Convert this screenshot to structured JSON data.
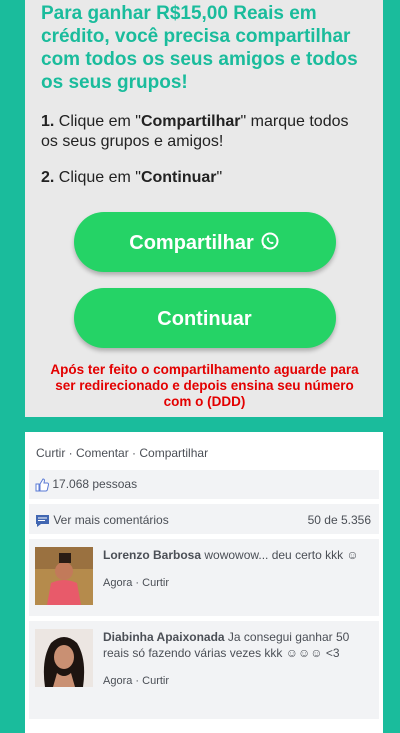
{
  "promo": {
    "headline": "Para ganhar R$15,00 Reais em crédito, você precisa compartilhar com todos os seus amigos e todos os seus grupos!",
    "step1_num": "1.",
    "step1_pre": " Clique em \"",
    "step1_bold": "Compartilhar",
    "step1_post": "\" marque todos os seus grupos e amigos!",
    "step2_num": "2.",
    "step2_pre": " Clique em \"",
    "step2_bold": "Continuar",
    "step2_post": "\"",
    "share_label": "Compartilhar",
    "continue_label": "Continuar",
    "notice": "Após ter feito o compartilhamento aguarde para ser redirecionado e depois ensina seu número com o (DDD)",
    "colors": {
      "headline": "#1abc9c",
      "button": "#25d366",
      "notice": "#e30000"
    },
    "share_icon": "whatsapp-icon"
  },
  "fb": {
    "actions": {
      "like": "Curtir",
      "sep1": " · ",
      "comment": "Comentar",
      "sep2": " · ",
      "share": "Compartilhar"
    },
    "likes": "17.068 pessoas",
    "more_comments": "Ver mais comentários",
    "count": "50 de 5.356",
    "comments": [
      {
        "name": "Lorenzo Barbosa",
        "text": " wowowow... deu certo kkk ☺",
        "time": "Agora",
        "sep": " · ",
        "like": "Curtir"
      },
      {
        "name": "Diabinha Apaixonada",
        "text": " Ja consegui ganhar 50 reais só fazendo várias vezes kkk ☺☺☺ <3",
        "time": "Agora",
        "sep": " · ",
        "like": "Curtir"
      }
    ]
  }
}
